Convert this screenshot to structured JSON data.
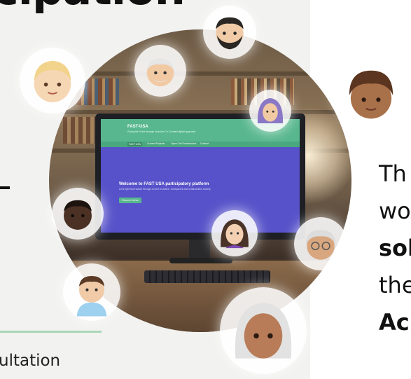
{
  "heading_fragment": "cipation",
  "caption_fragment": "ultation",
  "right_text": {
    "line1": "Th",
    "line2": "wo",
    "line3": "sol",
    "line4": "the",
    "line5": "Ac"
  },
  "monitor": {
    "logo": "FAST-USA",
    "tagline": "Giving the Voice through inclusive Co-Created digital approach",
    "tabs": [
      "FAST USA",
      "Current Projects",
      "Open Call Submissions",
      "Contact"
    ],
    "welcome": "Welcome to FAST USA participatory platform",
    "subtitle": "Let's fight food waste through a more inclusive, transparent and collaborative society",
    "button": "Discover Ideas"
  },
  "colors": {
    "accent_green": "#58b78e",
    "screen_purple": "#5752c9",
    "rule_green": "#a9d7b8"
  },
  "avatars": [
    "avatar-blond-person-icon",
    "avatar-bearded-man-icon",
    "avatar-old-man-icon",
    "avatar-hijab-woman-icon",
    "avatar-curly-hair-person-icon",
    "avatar-dark-skin-man-icon",
    "avatar-woman-brown-hair-icon",
    "avatar-old-woman-glasses-icon",
    "avatar-office-man-icon",
    "avatar-grey-hair-woman-icon"
  ]
}
